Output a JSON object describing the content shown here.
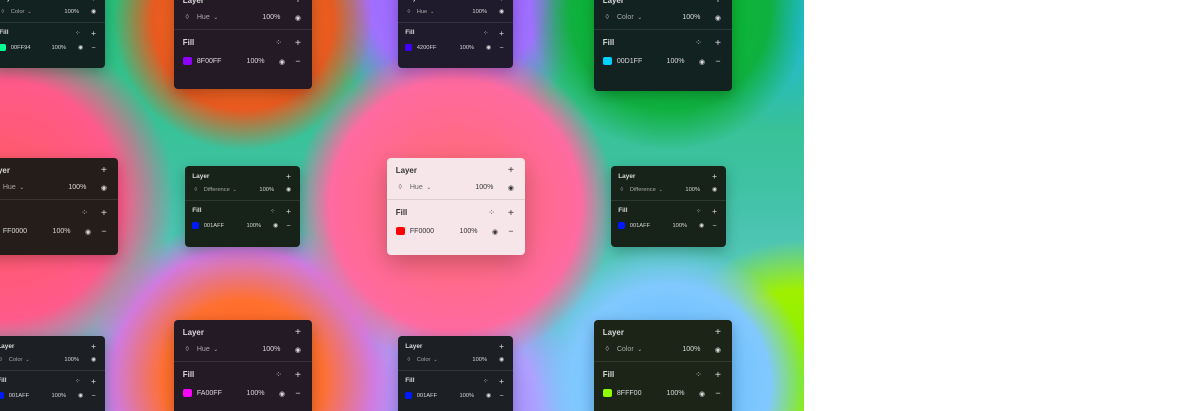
{
  "section_layer_label": "Layer",
  "section_fill_label": "Fill",
  "icons": {
    "add": "+",
    "remove": "−",
    "eye": "◉",
    "blend": "◊",
    "chevron": "⌄",
    "styles": "⁘"
  },
  "panels": [
    {
      "id": "top-left",
      "blend_mode": "Color",
      "layer_opacity": "100%",
      "fill_hex": "00FF94",
      "fill_opacity": "100%",
      "swatch": "#00FF94"
    },
    {
      "id": "top-center-left",
      "blend_mode": "Hue",
      "layer_opacity": "100%",
      "fill_hex": "8F00FF",
      "fill_opacity": "100%",
      "swatch": "#8F00FF"
    },
    {
      "id": "top-center",
      "blend_mode": "Hue",
      "layer_opacity": "100%",
      "fill_hex": "4200FF",
      "fill_opacity": "100%",
      "swatch": "#4200FF"
    },
    {
      "id": "top-right",
      "blend_mode": "Color",
      "layer_opacity": "100%",
      "fill_hex": "00D1FF",
      "fill_opacity": "100%",
      "swatch": "#00D1FF"
    },
    {
      "id": "mid-left",
      "blend_mode": "Hue",
      "layer_opacity": "100%",
      "fill_hex": "FF0000",
      "fill_opacity": "100%",
      "swatch": "#FF0000"
    },
    {
      "id": "mid-center-left",
      "blend_mode": "Difference",
      "layer_opacity": "100%",
      "fill_hex": "001AFF",
      "fill_opacity": "100%",
      "swatch": "#001AFF"
    },
    {
      "id": "mid-center",
      "blend_mode": "Hue",
      "layer_opacity": "100%",
      "fill_hex": "FF0000",
      "fill_opacity": "100%",
      "swatch": "#FF0000"
    },
    {
      "id": "mid-right",
      "blend_mode": "Difference",
      "layer_opacity": "100%",
      "fill_hex": "001AFF",
      "fill_opacity": "100%",
      "swatch": "#001AFF"
    },
    {
      "id": "bottom-left",
      "blend_mode": "Color",
      "layer_opacity": "100%",
      "fill_hex": "001AFF",
      "fill_opacity": "100%",
      "swatch": "#001AFF"
    },
    {
      "id": "bottom-center-left",
      "blend_mode": "Hue",
      "layer_opacity": "100%",
      "fill_hex": "FA00FF",
      "fill_opacity": "100%",
      "swatch": "#FA00FF"
    },
    {
      "id": "bottom-center",
      "blend_mode": "Color",
      "layer_opacity": "100%",
      "fill_hex": "001AFF",
      "fill_opacity": "100%",
      "swatch": "#001AFF"
    },
    {
      "id": "bottom-right",
      "blend_mode": "Color",
      "layer_opacity": "100%",
      "fill_hex": "8FFF00",
      "fill_opacity": "100%",
      "swatch": "#8FFF00"
    }
  ]
}
